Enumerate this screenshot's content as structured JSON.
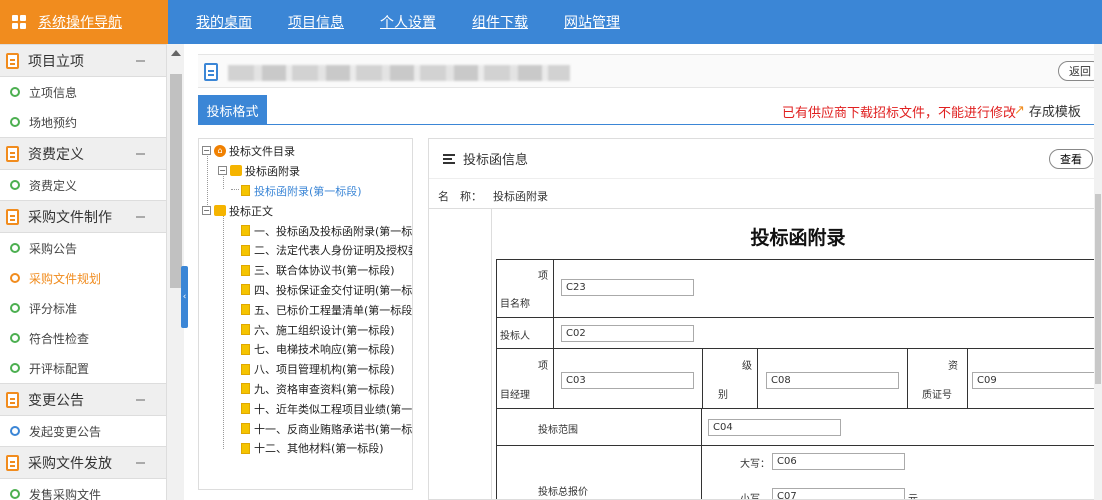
{
  "app": {
    "title": "系统操作导航"
  },
  "topnav": [
    "我的桌面",
    "项目信息",
    "个人设置",
    "组件下载",
    "网站管理"
  ],
  "sidebar": {
    "groups": [
      {
        "label": "项目立项",
        "items": [
          {
            "label": "立项信息"
          },
          {
            "label": "场地预约"
          }
        ]
      },
      {
        "label": "资费定义",
        "items": [
          {
            "label": "资费定义"
          }
        ]
      },
      {
        "label": "采购文件制作",
        "items": [
          {
            "label": "采购公告"
          },
          {
            "label": "采购文件规划"
          },
          {
            "label": "评分标准"
          },
          {
            "label": "符合性检查"
          },
          {
            "label": "开评标配置"
          }
        ]
      },
      {
        "label": "变更公告",
        "items": [
          {
            "label": "发起变更公告"
          }
        ]
      },
      {
        "label": "采购文件发放",
        "items": [
          {
            "label": "发售采购文件"
          }
        ]
      }
    ]
  },
  "toolbar": {
    "back_label": "返回"
  },
  "tab": {
    "label": "投标格式"
  },
  "warning": "已有供应商下载招标文件，不能进行修改",
  "save_template": "存成模板",
  "tree": {
    "root": "投标文件目录",
    "appendix_folder": "投标函附录",
    "appendix_item": "投标函附录(第一标段)",
    "body_folder": "投标正文",
    "body_items": [
      "一、投标函及投标函附录(第一标",
      "二、法定代表人身份证明及授权委",
      "三、联合体协议书(第一标段)",
      "四、投标保证金交付证明(第一标",
      "五、已标价工程量清单(第一标段",
      "六、施工组织设计(第一标段)",
      "七、电梯技术响应(第一标段)",
      "八、项目管理机构(第一标段)",
      "九、资格审查资料(第一标段)",
      "十、近年类似工程项目业绩(第一",
      "十一、反商业贿赂承诺书(第一标",
      "十二、其他材料(第一标段)"
    ]
  },
  "panel": {
    "title": "投标函信息",
    "view_label": "查看",
    "name_label": "名　称：",
    "name_value": "投标函附录"
  },
  "form": {
    "title": "投标函附录",
    "project_name_label_a": "项",
    "project_name_label_b": "目名称",
    "project_name_value": "C23",
    "bidder_label": "投标人",
    "bidder_value": "C02",
    "manager_label_a": "项",
    "manager_label_b": "目经理",
    "manager_value": "C03",
    "level_label_a": "级",
    "level_label_b": "别",
    "level_value": "C08",
    "cert_label_a": "资",
    "cert_label_b": "质证号",
    "cert_value": "C09",
    "scope_label": "投标范围",
    "scope_value": "C04",
    "total_label": "投标总报价",
    "upper_label": "大写：",
    "upper_value": "C06",
    "lower_label": "小写",
    "lower_value": "C07",
    "lower_unit": "元"
  }
}
